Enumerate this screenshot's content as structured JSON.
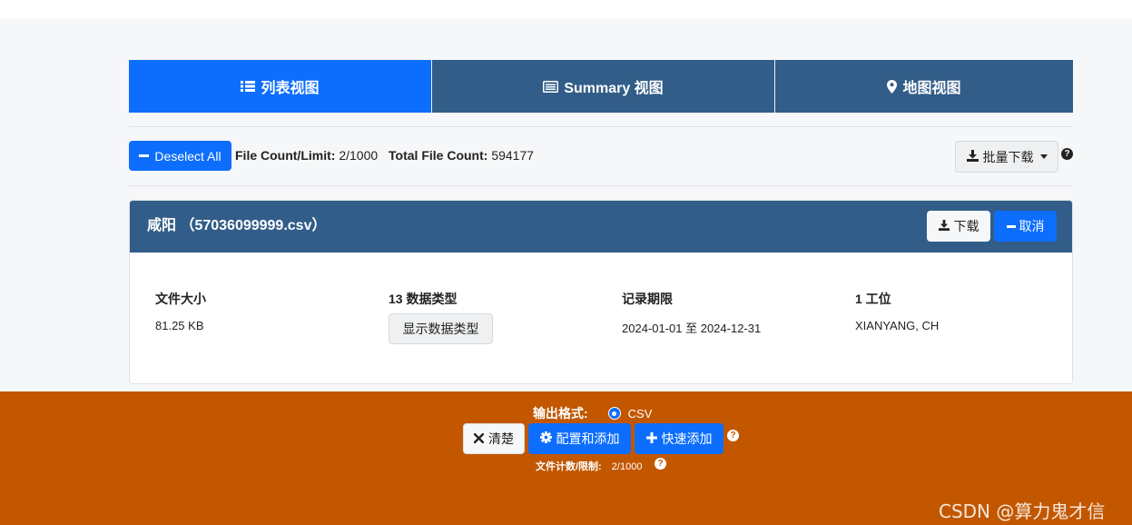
{
  "tabs": [
    {
      "label": "列表视图",
      "icon": "list-icon",
      "active": true
    },
    {
      "label": "Summary 视图",
      "icon": "summary-card-icon",
      "active": false
    },
    {
      "label": "地图视图",
      "icon": "map-marker-icon",
      "active": false
    }
  ],
  "toolbar": {
    "deselect_label": "Deselect All",
    "file_count_label": "File Count/Limit:",
    "file_count_value": "2/1000",
    "total_count_label": "Total File Count:",
    "total_count_value": "594177",
    "bulk_download_label": "批量下载",
    "help": "?"
  },
  "file_card": {
    "title": "咸阳 （57036099999.csv）",
    "download_label": "下载",
    "cancel_label": "取消",
    "size_heading": "文件大小",
    "size_value": "81.25 KB",
    "types_heading": "13 数据类型",
    "types_button": "显示数据类型",
    "period_heading": "记录期限",
    "period_value": "2024-01-01 至 2024-12-31",
    "station_heading": "1 工位",
    "station_value": "XIANYANG, CH"
  },
  "footer": {
    "format_label": "输出格式:",
    "format_option": "CSV",
    "clear_label": "清楚",
    "config_label": "配置和添加",
    "quick_label": "快速添加",
    "count_label": "文件计数/限制:",
    "count_value": "2/1000",
    "help": "?"
  },
  "watermark": "CSDN @算力鬼才信",
  "colors": {
    "primary": "#0d6efd",
    "header_blue": "#325d88",
    "footer_orange": "#c25700",
    "background": "#f6f7f9"
  }
}
